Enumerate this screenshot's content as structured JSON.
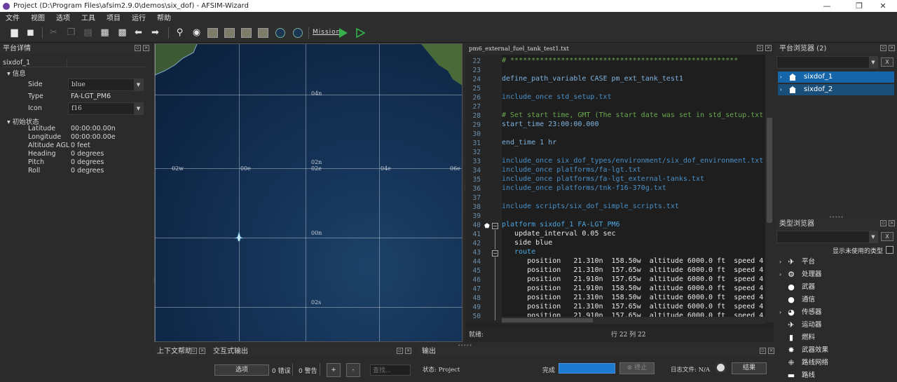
{
  "window": {
    "title": "Project (D:\\Program Files\\afsim2.9.0\\demos\\six_dof) - AFSIM-Wizard",
    "min": "—",
    "max": "❐",
    "close": "✕"
  },
  "menu": [
    "文件",
    "视图",
    "选项",
    "工具",
    "项目",
    "运行",
    "帮助"
  ],
  "toolbar": {
    "mission_label": "Mission"
  },
  "left_panel": {
    "title": "平台详情",
    "object_name": "sixdof_1",
    "section_info": "信息",
    "side_label": "Side",
    "side_value": "blue",
    "type_label": "Type",
    "type_value": "FA-LGT_PM6",
    "icon_label": "Icon",
    "icon_value": "f16",
    "section_initial": "初始状态",
    "props": [
      {
        "label": "Latitude",
        "value": "00:00:00.00n"
      },
      {
        "label": "Longitude",
        "value": "00:00:00.00e"
      },
      {
        "label": "Altitude AGL",
        "value": "0 feet"
      },
      {
        "label": "Heading",
        "value": "0 degrees"
      },
      {
        "label": "Pitch",
        "value": "0 degrees"
      },
      {
        "label": "Roll",
        "value": "0 degrees"
      }
    ]
  },
  "map": {
    "labels": [
      "04n",
      "02w",
      "00e",
      "02n",
      "02e",
      "04e",
      "06e",
      "00n",
      "02s"
    ]
  },
  "editor": {
    "filename": "pm6_external_fuel_tank_test1.txt",
    "line_numbers": [
      "22",
      "23",
      "24",
      "25",
      "26",
      "27",
      "28",
      "29",
      "30",
      "31",
      "32",
      "33",
      "34",
      "35",
      "36",
      "37",
      "38",
      "39",
      "40",
      "41",
      "42",
      "43",
      "44",
      "45",
      "46",
      "47",
      "48",
      "49",
      "50"
    ],
    "lines": [
      "# ******************************************************",
      "",
      "define_path_variable CASE pm_ext_tank_test1",
      "",
      "include_once std_setup.txt",
      "",
      "# Set start time, GMT (The start date was set in std_setup.txt",
      "start_time 23:00:00.000",
      "",
      "end_time 1 hr",
      "",
      "include_once six_dof_types/environment/six_dof_environment.txt",
      "include_once platforms/fa-lgt.txt",
      "include_once platforms/fa-lgt_external-tanks.txt",
      "include_once platforms/tnk-f16-370g.txt",
      "",
      "include scripts/six_dof_simple_scripts.txt",
      "",
      "platform sixdof_1 FA-LGT_PM6",
      "   update_interval 0.05 sec",
      "   side blue",
      "   route",
      "      position   21.310n  158.50w  altitude 6000.0 ft  speed 4",
      "      position   21.310n  157.65w  altitude 6000.0 ft  speed 4",
      "      position   21.910n  157.65w  altitude 6000.0 ft  speed 4",
      "      position   21.910n  158.50w  altitude 6000.0 ft  speed 4",
      "      position   21.310n  158.50w  altitude 6000.0 ft  speed 4",
      "      position   21.310n  157.65w  altitude 6000.0 ft  speed 4",
      "      position   21.910n  157.65w  altitude 6000.0 ft  speed 4"
    ],
    "status_ready": "就绪:",
    "status_pos": "行 22  列 22"
  },
  "platform_browser": {
    "title": "平台浏览器 (2)",
    "clear": "X",
    "items": [
      "sixdof_1",
      "sixdof_2"
    ]
  },
  "type_browser": {
    "title": "类型浏览器",
    "clear": "X",
    "show_unused": "显示未使用的类型",
    "items": [
      "平台",
      "处理器",
      "武器",
      "通信",
      "传感器",
      "运动器",
      "燃料",
      "武器效果",
      "路线网络",
      "路线"
    ]
  },
  "bottom": {
    "context_help_title": "上下文帮助",
    "interactive_title": "交互式输出",
    "options_btn": "选项",
    "errors": "0 错误",
    "warnings": "0 警告",
    "plus": "+",
    "minus": "-",
    "search_placeholder": "查找...",
    "output_title": "输出",
    "status_text": "状态: Project",
    "done_label": "完成",
    "stop_label": "终止",
    "logfile_label": "日志文件: N/A",
    "result_btn": "结果"
  }
}
